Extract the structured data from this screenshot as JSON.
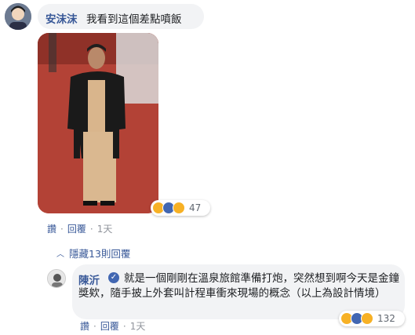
{
  "comment1": {
    "author": "安沫沫",
    "text": "我看到這個差點噴飯",
    "reaction_count": "47",
    "actions": {
      "reply1": "讚",
      "reply2": "回覆",
      "time": "1天"
    }
  },
  "hidden_replies": {
    "label": "隱藏13則回覆"
  },
  "comment2": {
    "author": "陳沂",
    "verified": "✓",
    "text": "就是一個剛剛在溫泉旅館準備打炮，突然想到啊今天是金鐘獎欸，隨手披上外套叫計程車衝來現場的概念（以上為設計情境）",
    "reaction_count": "132",
    "actions": {
      "reply1": "讚",
      "reply2": "回覆",
      "time": "1天"
    }
  },
  "icons": {
    "reactions": [
      "haha-icon",
      "like-icon",
      "wow-icon"
    ],
    "hidden_chevron": "chevron-up-icon"
  },
  "colors": {
    "link": "#385898",
    "bubble": "#f2f3f5",
    "like": "#4267b2",
    "haha": "#f7b125"
  }
}
